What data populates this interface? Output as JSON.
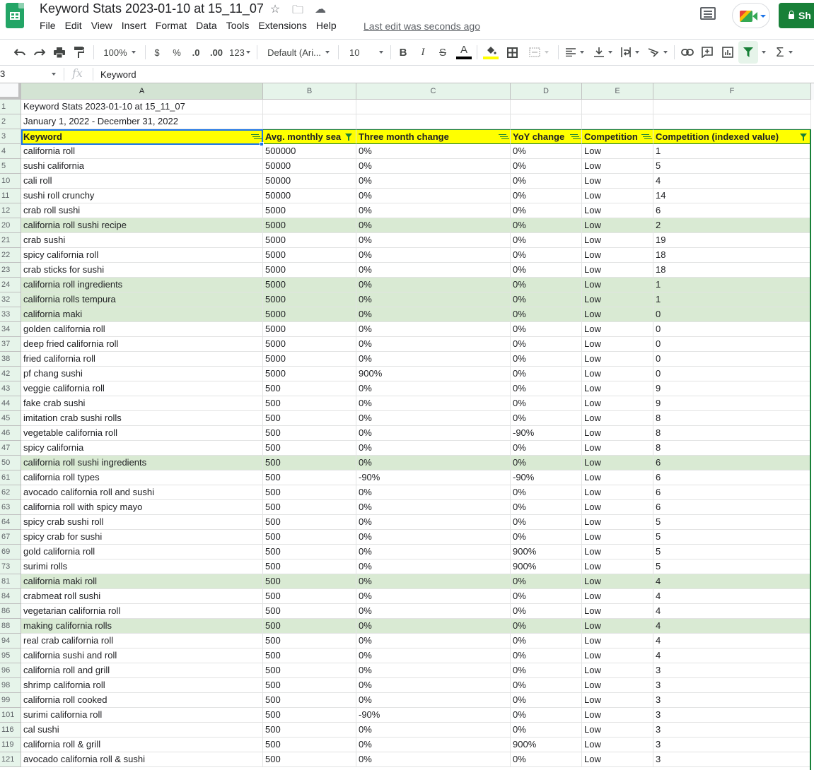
{
  "app": {
    "doc_title": "Keyword Stats 2023-01-10 at 15_11_07",
    "title_icons": [
      "star-icon",
      "move-to-folder-icon",
      "cloud-saved-icon"
    ],
    "menu": [
      "File",
      "Edit",
      "View",
      "Insert",
      "Format",
      "Data",
      "Tools",
      "Extensions",
      "Help"
    ],
    "last_edit": "Last edit was seconds ago",
    "share_label": "Sh",
    "accent_color": "#188038"
  },
  "toolbar": {
    "zoom": "100%",
    "currency": "$",
    "percent": "%",
    "decrease_decimal": ".0",
    "increase_decimal": ".00",
    "more_formats": "123",
    "font": "Default (Ari...",
    "font_size": "10",
    "bold": "B",
    "italic": "I",
    "strikethrough": "S",
    "text_color_label": "A",
    "text_color": "#000000",
    "fill_color": "#ffff00",
    "sum": "Σ"
  },
  "formula_bar": {
    "name_box": "3",
    "fx": "fx",
    "formula": "Keyword"
  },
  "columns": [
    "A",
    "B",
    "C",
    "D",
    "E",
    "F"
  ],
  "title_rows": [
    {
      "row": "1",
      "text": "Keyword Stats 2023-01-10 at 15_11_07"
    },
    {
      "row": "2",
      "text": "January 1, 2022 - December 31, 2022"
    }
  ],
  "header_row": {
    "row": "3",
    "cells": [
      {
        "label": "Keyword",
        "filter": "off"
      },
      {
        "label": "Avg. monthly sea",
        "filter": "on"
      },
      {
        "label": "Three month change",
        "filter": "off"
      },
      {
        "label": "YoY change",
        "filter": "off"
      },
      {
        "label": "Competition",
        "filter": "off"
      },
      {
        "label": "Competition (indexed value)",
        "filter": "on"
      }
    ]
  },
  "rows": [
    {
      "row": "4",
      "keyword": "california roll",
      "volume": "500000",
      "three_month": "0%",
      "yoy": "0%",
      "competition": "Low",
      "index": "1",
      "highlight": false
    },
    {
      "row": "5",
      "keyword": "sushi california",
      "volume": "50000",
      "three_month": "0%",
      "yoy": "0%",
      "competition": "Low",
      "index": "5",
      "highlight": false
    },
    {
      "row": "10",
      "keyword": "cali roll",
      "volume": "50000",
      "three_month": "0%",
      "yoy": "0%",
      "competition": "Low",
      "index": "4",
      "highlight": false
    },
    {
      "row": "11",
      "keyword": "sushi roll crunchy",
      "volume": "50000",
      "three_month": "0%",
      "yoy": "0%",
      "competition": "Low",
      "index": "14",
      "highlight": false
    },
    {
      "row": "12",
      "keyword": "crab roll sushi",
      "volume": "5000",
      "three_month": "0%",
      "yoy": "0%",
      "competition": "Low",
      "index": "6",
      "highlight": false
    },
    {
      "row": "20",
      "keyword": "california roll sushi recipe",
      "volume": "5000",
      "three_month": "0%",
      "yoy": "0%",
      "competition": "Low",
      "index": "2",
      "highlight": true
    },
    {
      "row": "21",
      "keyword": "crab sushi",
      "volume": "5000",
      "three_month": "0%",
      "yoy": "0%",
      "competition": "Low",
      "index": "19",
      "highlight": false
    },
    {
      "row": "22",
      "keyword": "spicy california roll",
      "volume": "5000",
      "three_month": "0%",
      "yoy": "0%",
      "competition": "Low",
      "index": "18",
      "highlight": false
    },
    {
      "row": "23",
      "keyword": "crab sticks for sushi",
      "volume": "5000",
      "three_month": "0%",
      "yoy": "0%",
      "competition": "Low",
      "index": "18",
      "highlight": false
    },
    {
      "row": "24",
      "keyword": "california roll ingredients",
      "volume": "5000",
      "three_month": "0%",
      "yoy": "0%",
      "competition": "Low",
      "index": "1",
      "highlight": true
    },
    {
      "row": "32",
      "keyword": "california rolls tempura",
      "volume": "5000",
      "three_month": "0%",
      "yoy": "0%",
      "competition": "Low",
      "index": "1",
      "highlight": true
    },
    {
      "row": "33",
      "keyword": "california maki",
      "volume": "5000",
      "three_month": "0%",
      "yoy": "0%",
      "competition": "Low",
      "index": "0",
      "highlight": true
    },
    {
      "row": "34",
      "keyword": "golden california roll",
      "volume": "5000",
      "three_month": "0%",
      "yoy": "0%",
      "competition": "Low",
      "index": "0",
      "highlight": false
    },
    {
      "row": "37",
      "keyword": "deep fried california roll",
      "volume": "5000",
      "three_month": "0%",
      "yoy": "0%",
      "competition": "Low",
      "index": "0",
      "highlight": false
    },
    {
      "row": "38",
      "keyword": "fried california roll",
      "volume": "5000",
      "three_month": "0%",
      "yoy": "0%",
      "competition": "Low",
      "index": "0",
      "highlight": false
    },
    {
      "row": "42",
      "keyword": "pf chang sushi",
      "volume": "5000",
      "three_month": "900%",
      "yoy": "0%",
      "competition": "Low",
      "index": "0",
      "highlight": false
    },
    {
      "row": "43",
      "keyword": "veggie california roll",
      "volume": "500",
      "three_month": "0%",
      "yoy": "0%",
      "competition": "Low",
      "index": "9",
      "highlight": false
    },
    {
      "row": "44",
      "keyword": "fake crab sushi",
      "volume": "500",
      "three_month": "0%",
      "yoy": "0%",
      "competition": "Low",
      "index": "9",
      "highlight": false
    },
    {
      "row": "45",
      "keyword": "imitation crab sushi rolls",
      "volume": "500",
      "three_month": "0%",
      "yoy": "0%",
      "competition": "Low",
      "index": "8",
      "highlight": false
    },
    {
      "row": "46",
      "keyword": "vegetable california roll",
      "volume": "500",
      "three_month": "0%",
      "yoy": "-90%",
      "competition": "Low",
      "index": "8",
      "highlight": false
    },
    {
      "row": "47",
      "keyword": "spicy california",
      "volume": "500",
      "three_month": "0%",
      "yoy": "0%",
      "competition": "Low",
      "index": "8",
      "highlight": false
    },
    {
      "row": "50",
      "keyword": "california roll sushi ingredients",
      "volume": "500",
      "three_month": "0%",
      "yoy": "0%",
      "competition": "Low",
      "index": "6",
      "highlight": true
    },
    {
      "row": "61",
      "keyword": "california roll types",
      "volume": "500",
      "three_month": "-90%",
      "yoy": "-90%",
      "competition": "Low",
      "index": "6",
      "highlight": false
    },
    {
      "row": "62",
      "keyword": "avocado california roll and sushi",
      "volume": "500",
      "three_month": "0%",
      "yoy": "0%",
      "competition": "Low",
      "index": "6",
      "highlight": false
    },
    {
      "row": "63",
      "keyword": "california roll with spicy mayo",
      "volume": "500",
      "three_month": "0%",
      "yoy": "0%",
      "competition": "Low",
      "index": "6",
      "highlight": false
    },
    {
      "row": "64",
      "keyword": "spicy crab sushi roll",
      "volume": "500",
      "three_month": "0%",
      "yoy": "0%",
      "competition": "Low",
      "index": "5",
      "highlight": false
    },
    {
      "row": "67",
      "keyword": "spicy crab for sushi",
      "volume": "500",
      "three_month": "0%",
      "yoy": "0%",
      "competition": "Low",
      "index": "5",
      "highlight": false
    },
    {
      "row": "69",
      "keyword": "gold california roll",
      "volume": "500",
      "three_month": "0%",
      "yoy": "900%",
      "competition": "Low",
      "index": "5",
      "highlight": false
    },
    {
      "row": "73",
      "keyword": "surimi rolls",
      "volume": "500",
      "three_month": "0%",
      "yoy": "900%",
      "competition": "Low",
      "index": "5",
      "highlight": false
    },
    {
      "row": "81",
      "keyword": "california maki roll",
      "volume": "500",
      "three_month": "0%",
      "yoy": "0%",
      "competition": "Low",
      "index": "4",
      "highlight": true
    },
    {
      "row": "84",
      "keyword": "crabmeat roll sushi",
      "volume": "500",
      "three_month": "0%",
      "yoy": "0%",
      "competition": "Low",
      "index": "4",
      "highlight": false
    },
    {
      "row": "86",
      "keyword": "vegetarian california roll",
      "volume": "500",
      "three_month": "0%",
      "yoy": "0%",
      "competition": "Low",
      "index": "4",
      "highlight": false
    },
    {
      "row": "88",
      "keyword": "making california rolls",
      "volume": "500",
      "three_month": "0%",
      "yoy": "0%",
      "competition": "Low",
      "index": "4",
      "highlight": true
    },
    {
      "row": "94",
      "keyword": "real crab california roll",
      "volume": "500",
      "three_month": "0%",
      "yoy": "0%",
      "competition": "Low",
      "index": "4",
      "highlight": false
    },
    {
      "row": "95",
      "keyword": "california sushi and roll",
      "volume": "500",
      "three_month": "0%",
      "yoy": "0%",
      "competition": "Low",
      "index": "4",
      "highlight": false
    },
    {
      "row": "96",
      "keyword": "california roll and grill",
      "volume": "500",
      "three_month": "0%",
      "yoy": "0%",
      "competition": "Low",
      "index": "3",
      "highlight": false
    },
    {
      "row": "98",
      "keyword": "shrimp california roll",
      "volume": "500",
      "three_month": "0%",
      "yoy": "0%",
      "competition": "Low",
      "index": "3",
      "highlight": false
    },
    {
      "row": "99",
      "keyword": "california roll cooked",
      "volume": "500",
      "three_month": "0%",
      "yoy": "0%",
      "competition": "Low",
      "index": "3",
      "highlight": false
    },
    {
      "row": "101",
      "keyword": "surimi california roll",
      "volume": "500",
      "three_month": "-90%",
      "yoy": "0%",
      "competition": "Low",
      "index": "3",
      "highlight": false
    },
    {
      "row": "116",
      "keyword": "cal sushi",
      "volume": "500",
      "three_month": "0%",
      "yoy": "0%",
      "competition": "Low",
      "index": "3",
      "highlight": false
    },
    {
      "row": "119",
      "keyword": "california roll & grill",
      "volume": "500",
      "three_month": "0%",
      "yoy": "900%",
      "competition": "Low",
      "index": "3",
      "highlight": false
    },
    {
      "row": "121",
      "keyword": "avocado california roll & sushi",
      "volume": "500",
      "three_month": "0%",
      "yoy": "0%",
      "competition": "Low",
      "index": "3",
      "highlight": false
    }
  ],
  "colors": {
    "header_fill": "#ffff00",
    "highlight_fill": "#d9ead3",
    "filter_green": "#188038",
    "selection_blue": "#1a73e8"
  }
}
